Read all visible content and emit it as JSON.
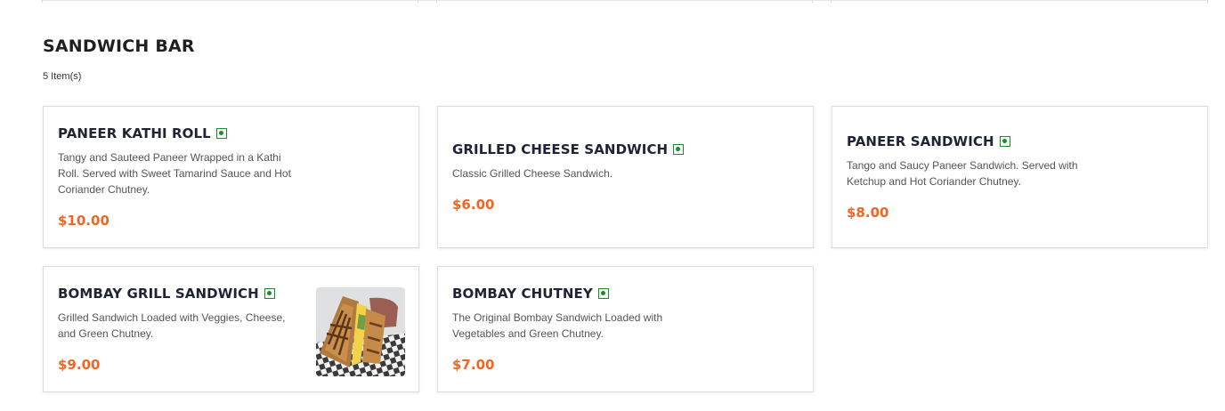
{
  "section": {
    "title": "SANDWICH BAR",
    "count": "5 Item(s)"
  },
  "items": [
    {
      "name": "PANEER KATHI ROLL",
      "description": "Tangy and Sauteed Paneer Wrapped in a Kathi Roll. Served with Sweet Tamarind Sauce and Hot Coriander Chutney.",
      "price": "$10.00",
      "veg": true
    },
    {
      "name": "GRILLED CHEESE SANDWICH",
      "description": "Classic Grilled Cheese Sandwich.",
      "price": "$6.00",
      "veg": true
    },
    {
      "name": "PANEER SANDWICH",
      "description": "Tango and Saucy Paneer Sandwich. Served with Ketchup and Hot Coriander Chutney.",
      "price": "$8.00",
      "veg": true
    },
    {
      "name": "BOMBAY GRILL SANDWICH",
      "description": "Grilled Sandwich Loaded with Veggies, Cheese, and Green Chutney.",
      "price": "$9.00",
      "veg": true,
      "image": "grilled-sandwich-photo"
    },
    {
      "name": "BOMBAY CHUTNEY",
      "description": "The Original Bombay Sandwich Loaded with Vegetables and Green Chutney.",
      "price": "$7.00",
      "veg": true
    }
  ],
  "colors": {
    "price": "#f26522",
    "veg_indicator": "#1d8a2c",
    "title": "#1e2433"
  }
}
